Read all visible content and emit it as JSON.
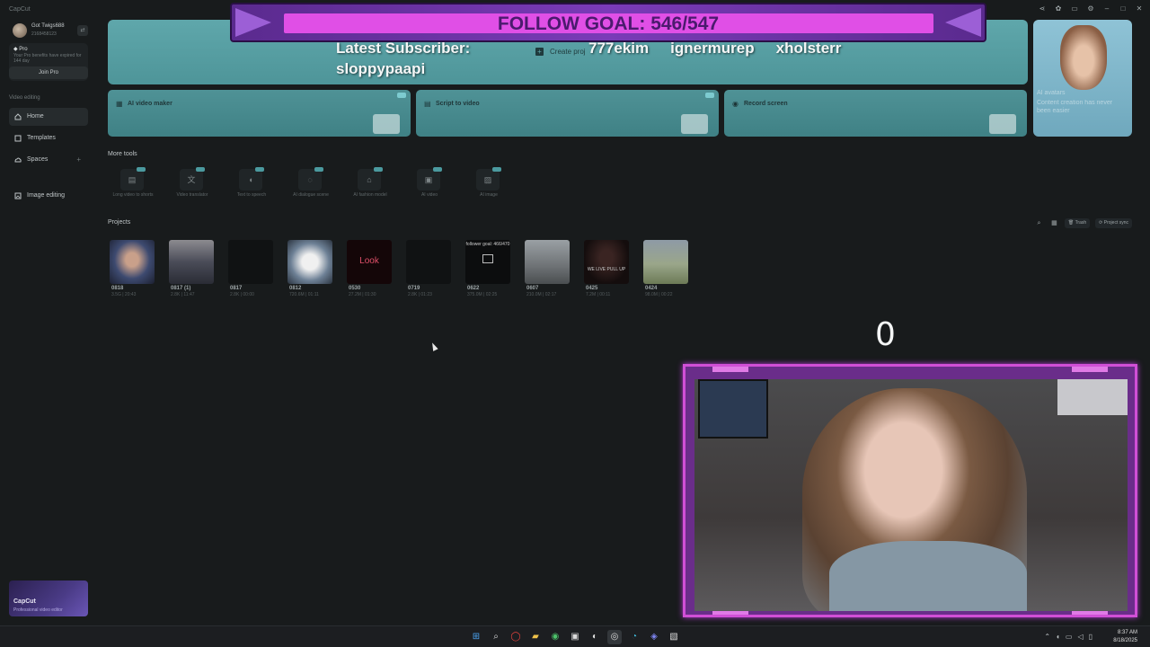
{
  "app": {
    "title": "CapCut"
  },
  "window_controls": [
    "share-icon",
    "gear-icon",
    "screen-icon",
    "settings-icon",
    "minimize-icon",
    "maximize-icon",
    "close-icon"
  ],
  "sidebar": {
    "user": {
      "name": "Got Twigs688",
      "id": "2168458123"
    },
    "pro": {
      "title": "Pro",
      "desc": "Your Pro benefits have expired for 144 day",
      "join_label": "Join Pro"
    },
    "section_label": "Video editing",
    "items": [
      {
        "label": "Home",
        "icon": "home-icon"
      },
      {
        "label": "Templates",
        "icon": "template-icon"
      },
      {
        "label": "Spaces",
        "icon": "cloud-icon"
      },
      {
        "label": "Image editing",
        "icon": "image-icon"
      }
    ],
    "promo": {
      "title": "CapCut",
      "subtitle": "Professional video editor"
    }
  },
  "main": {
    "create_label": "Create proj",
    "side_promo": {
      "line1": "AI avatars",
      "line2": "Content creation has never been easier"
    },
    "tool_cards": [
      {
        "label": "AI video maker",
        "icon": "video-icon"
      },
      {
        "label": "Script to video",
        "icon": "script-icon"
      },
      {
        "label": "Record screen",
        "icon": "record-icon"
      }
    ],
    "more_tools_title": "More tools",
    "more_tools": [
      {
        "label": "Long video to shorts",
        "icon": "film-icon",
        "glyph": "▤"
      },
      {
        "label": "Video translator",
        "icon": "translate-icon",
        "glyph": "文"
      },
      {
        "label": "Text to speech",
        "icon": "speech-icon",
        "glyph": "◖"
      },
      {
        "label": "AI dialogue scene",
        "icon": "dialogue-icon",
        "glyph": "◌"
      },
      {
        "label": "AI fashion model",
        "icon": "shirt-icon",
        "glyph": "⌂"
      },
      {
        "label": "AI video",
        "icon": "ai-video-icon",
        "glyph": "▣"
      },
      {
        "label": "AI image",
        "icon": "ai-image-icon",
        "glyph": "▨"
      }
    ],
    "projects_title": "Projects",
    "project_tools": {
      "trash_label": "Trash",
      "sync_label": "Project sync"
    },
    "projects": [
      {
        "name": "0818",
        "meta": "3.5G | 20:43",
        "thumb": "person"
      },
      {
        "name": "0817 (1)",
        "meta": "2.8K | 11:47",
        "thumb": "group"
      },
      {
        "name": "0817",
        "meta": "2.8K | 00:00",
        "thumb": "dark"
      },
      {
        "name": "0812",
        "meta": "720.6M | 01:11",
        "thumb": "white"
      },
      {
        "name": "0530",
        "meta": "27.2M | 01:30",
        "thumb": "look",
        "text": "Look"
      },
      {
        "name": "0719",
        "meta": "2.8K | 01:23",
        "thumb": "dark"
      },
      {
        "name": "0622",
        "meta": "375.0M | 02:25",
        "thumb": "screen",
        "text": "follower goal: 466/470"
      },
      {
        "name": "0607",
        "meta": "210.0M | 02:17",
        "thumb": "street"
      },
      {
        "name": "0425",
        "meta": "7.2M | 00:11",
        "thumb": "caption",
        "text": "WE LIVE PULL UP"
      },
      {
        "name": "0424",
        "meta": "98.0M | 00:22",
        "thumb": "outdoor"
      }
    ]
  },
  "overlay": {
    "goal_text": "FOLLOW GOAL: 546/547",
    "goal_progress": 0.998,
    "subscriber_label": "Latest Subscriber:",
    "subscriber_name": "sloppypaapi",
    "recent": [
      "777ekim",
      "ignermurep",
      "xholsterr"
    ],
    "counter": "0"
  },
  "taskbar": {
    "icons": [
      "windows-icon",
      "search-icon",
      "opera-icon",
      "folder-icon",
      "spotify-icon",
      "store-icon",
      "steam-icon",
      "obs-icon",
      "edge-icon",
      "discord-icon",
      "capcut-icon"
    ],
    "time": "8:37 AM",
    "date": "8/18/2025"
  },
  "colors": {
    "banner": "#5fa7ab",
    "overlay_purple": "#7a3bb8",
    "overlay_pink": "#e04fe6",
    "background": "#181b1c"
  }
}
